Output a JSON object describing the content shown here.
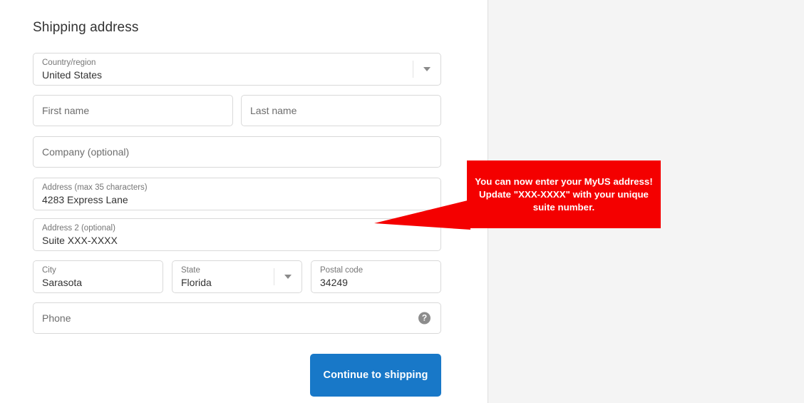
{
  "page": {
    "title": "Shipping address",
    "background": "#ffffff",
    "right_panel_color": "#f4f4f4"
  },
  "form": {
    "fields": [
      {
        "name": "country",
        "label": "Country/region",
        "value": "United States",
        "placeholder": "",
        "type": "select"
      },
      {
        "name": "first_name",
        "label": "",
        "value": "",
        "placeholder": "First name",
        "type": "text"
      },
      {
        "name": "last_name",
        "label": "",
        "value": "",
        "placeholder": "Last name",
        "type": "text"
      },
      {
        "name": "company",
        "label": "",
        "value": "",
        "placeholder": "Company (optional)",
        "type": "text"
      },
      {
        "name": "address",
        "label": "Address (max 35 characters)",
        "value": "4283 Express Lane",
        "placeholder": "",
        "type": "text"
      },
      {
        "name": "address2",
        "label": "Address 2 (optional)",
        "value": "Suite XXX-XXXX",
        "placeholder": "",
        "type": "text"
      },
      {
        "name": "city",
        "label": "City",
        "value": "Sarasota",
        "placeholder": "",
        "type": "text"
      },
      {
        "name": "state",
        "label": "State",
        "value": "Florida",
        "placeholder": "",
        "type": "select"
      },
      {
        "name": "postal_code",
        "label": "Postal code",
        "value": "34249",
        "placeholder": "",
        "type": "text"
      },
      {
        "name": "phone",
        "label": "",
        "value": "",
        "placeholder": "Phone",
        "type": "tel",
        "icon": "help-circle-icon"
      }
    ],
    "submit_label": "Continue to shipping",
    "submit_color": "#1878c8"
  },
  "callout": {
    "text": "You can now enter your MyUS address! Update \"XXX-XXXX\" with your unique suite number.",
    "color": "#f40000",
    "text_color": "#ffffff"
  },
  "icons": {
    "dropdown_arrow": "chevron-down-icon",
    "help": "help-circle-icon",
    "help_glyph": "?"
  }
}
